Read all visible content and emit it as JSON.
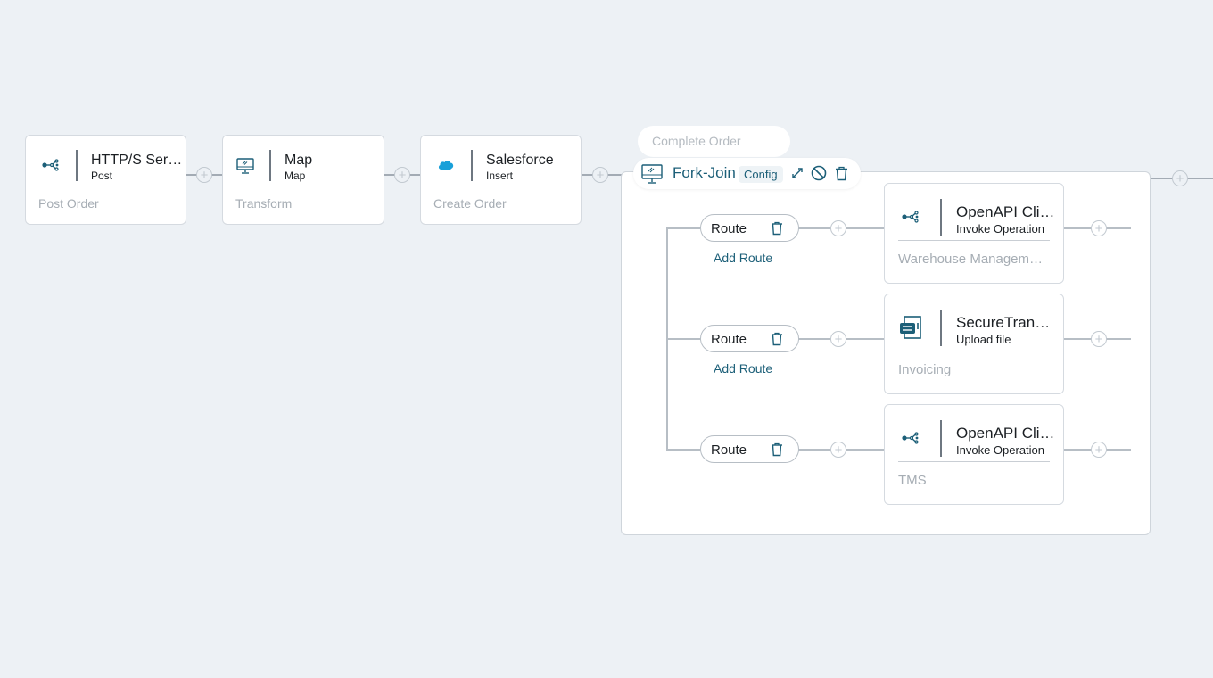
{
  "steps": [
    {
      "title": "HTTP/S Ser…",
      "subtitle": "Post",
      "description": "Post Order",
      "icon": "api-connector-icon"
    },
    {
      "title": "Map",
      "subtitle": "Map",
      "description": "Transform",
      "icon": "monitor-map-icon"
    },
    {
      "title": "Salesforce",
      "subtitle": "Insert",
      "description": "Create Order",
      "icon": "salesforce-cloud-icon"
    }
  ],
  "fork_join": {
    "step_name": "Complete Order",
    "title": "Fork-Join",
    "config_label": "Config",
    "icons": [
      "monitor-fork-icon",
      "expand-icon",
      "disable-icon",
      "trash-icon"
    ],
    "routes": [
      {
        "label": "Route",
        "add_route": "Add Route",
        "target": {
          "title": "OpenAPI Cli…",
          "subtitle": "Invoke Operation",
          "description": "Warehouse Managem…",
          "icon": "api-connector-icon"
        }
      },
      {
        "label": "Route",
        "add_route": "Add Route",
        "target": {
          "title": "SecureTran…",
          "subtitle": "Upload file",
          "description": "Invoicing",
          "icon": "secure-transport-icon"
        }
      },
      {
        "label": "Route",
        "target": {
          "title": "OpenAPI Cli…",
          "subtitle": "Invoke Operation",
          "description": "TMS",
          "icon": "api-connector-icon"
        }
      }
    ]
  },
  "add_step_symbol": "+",
  "colors": {
    "background": "#edf1f5",
    "accent": "#1c5f78",
    "connector": "#a3abb4",
    "salesforce": "#19a0d9",
    "muted_text": "#a6adb4"
  }
}
